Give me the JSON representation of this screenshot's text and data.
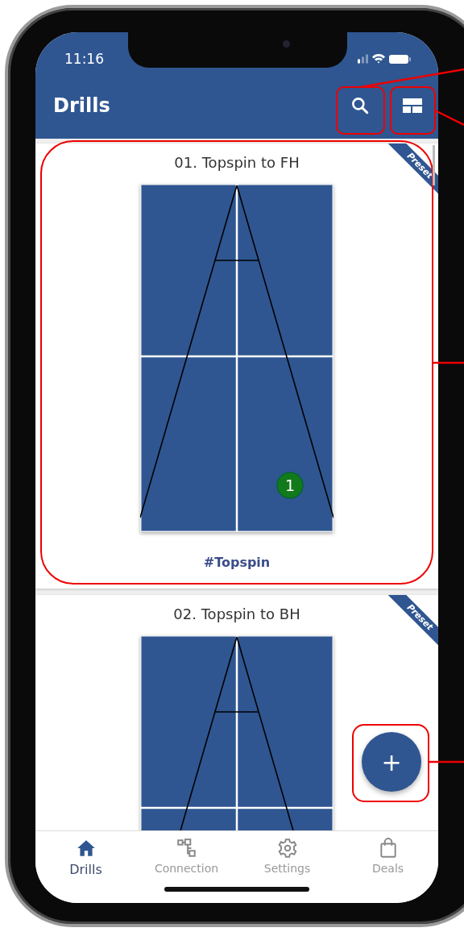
{
  "status_bar": {
    "time": "11:16"
  },
  "app_bar": {
    "title": "Drills"
  },
  "drills": [
    {
      "title": "01. Topspin to FH",
      "badge": "Preset",
      "ball": "1",
      "tag": "#Topspin"
    },
    {
      "title": "02. Topspin to BH",
      "badge": "Preset"
    }
  ],
  "fab": {
    "label": "+"
  },
  "bottom_nav": [
    {
      "label": "Drills",
      "kind": "home",
      "selected": true
    },
    {
      "label": "Connection",
      "kind": "network",
      "selected": false
    },
    {
      "label": "Settings",
      "kind": "gear",
      "selected": false
    },
    {
      "label": "Deals",
      "kind": "bag",
      "selected": false
    }
  ]
}
